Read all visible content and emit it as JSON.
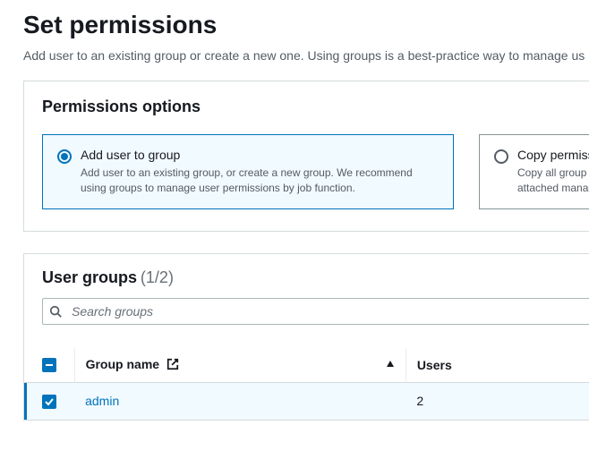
{
  "header": {
    "title": "Set permissions",
    "subtitle": "Add user to an existing group or create a new one. Using groups is a best-practice way to manage us"
  },
  "options": {
    "panel_title": "Permissions options",
    "add_to_group": {
      "title": "Add user to group",
      "description": "Add user to an existing group, or create a new group. We recommend using groups to manage user permissions by job function."
    },
    "copy_permissions": {
      "title": "Copy permiss",
      "description": "Copy all group memberships, attached managed policies from an"
    }
  },
  "groups": {
    "title": "User groups",
    "count_label": "(1/2)",
    "search_placeholder": "Search groups",
    "columns": {
      "name": "Group name",
      "users": "Users"
    },
    "rows": [
      {
        "name": "admin",
        "users": "2",
        "selected": true
      }
    ]
  }
}
